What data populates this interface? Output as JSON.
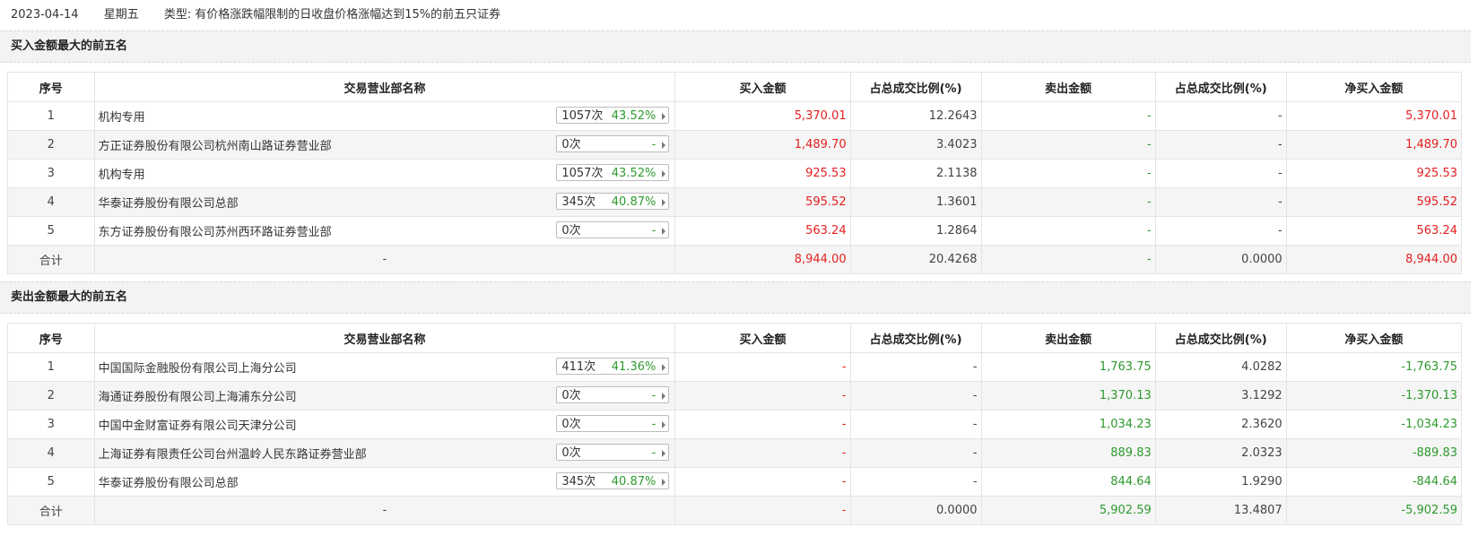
{
  "header": {
    "date": "2023-04-14",
    "weekday": "星期五",
    "type_label": "类型:",
    "type_value": "有价格涨跌幅限制的日收盘价格涨幅达到15%的前五只证券"
  },
  "columns": [
    "序号",
    "交易营业部名称",
    "买入金额",
    "占总成交比例(%)",
    "卖出金额",
    "占总成交比例(%)",
    "净买入金额"
  ],
  "buy_section": {
    "title": "买入金额最大的前五名",
    "rows": [
      {
        "idx": "1",
        "name": "机构专用",
        "count": "1057次",
        "pct": "43.52%",
        "buy": "5,370.01",
        "buy_ratio": "12.2643",
        "sell": "-",
        "sell_ratio": "-",
        "net": "5,370.01"
      },
      {
        "idx": "2",
        "name": "方正证券股份有限公司杭州南山路证券营业部",
        "count": "0次",
        "pct": "-",
        "buy": "1,489.70",
        "buy_ratio": "3.4023",
        "sell": "-",
        "sell_ratio": "-",
        "net": "1,489.70"
      },
      {
        "idx": "3",
        "name": "机构专用",
        "count": "1057次",
        "pct": "43.52%",
        "buy": "925.53",
        "buy_ratio": "2.1138",
        "sell": "-",
        "sell_ratio": "-",
        "net": "925.53"
      },
      {
        "idx": "4",
        "name": "华泰证券股份有限公司总部",
        "count": "345次",
        "pct": "40.87%",
        "buy": "595.52",
        "buy_ratio": "1.3601",
        "sell": "-",
        "sell_ratio": "-",
        "net": "595.52"
      },
      {
        "idx": "5",
        "name": "东方证券股份有限公司苏州西环路证券营业部",
        "count": "0次",
        "pct": "-",
        "buy": "563.24",
        "buy_ratio": "1.2864",
        "sell": "-",
        "sell_ratio": "-",
        "net": "563.24"
      }
    ],
    "total": {
      "label": "合计",
      "name": "-",
      "buy": "8,944.00",
      "buy_ratio": "20.4268",
      "sell": "-",
      "sell_ratio": "0.0000",
      "net": "8,944.00"
    }
  },
  "sell_section": {
    "title": "卖出金额最大的前五名",
    "rows": [
      {
        "idx": "1",
        "name": "中国国际金融股份有限公司上海分公司",
        "count": "411次",
        "pct": "41.36%",
        "buy": "-",
        "buy_ratio": "-",
        "sell": "1,763.75",
        "sell_ratio": "4.0282",
        "net": "-1,763.75"
      },
      {
        "idx": "2",
        "name": "海通证券股份有限公司上海浦东分公司",
        "count": "0次",
        "pct": "-",
        "buy": "-",
        "buy_ratio": "-",
        "sell": "1,370.13",
        "sell_ratio": "3.1292",
        "net": "-1,370.13"
      },
      {
        "idx": "3",
        "name": "中国中金财富证券有限公司天津分公司",
        "count": "0次",
        "pct": "-",
        "buy": "-",
        "buy_ratio": "-",
        "sell": "1,034.23",
        "sell_ratio": "2.3620",
        "net": "-1,034.23"
      },
      {
        "idx": "4",
        "name": "上海证券有限责任公司台州温岭人民东路证券营业部",
        "count": "0次",
        "pct": "-",
        "buy": "-",
        "buy_ratio": "-",
        "sell": "889.83",
        "sell_ratio": "2.0323",
        "net": "-889.83"
      },
      {
        "idx": "5",
        "name": "华泰证券股份有限公司总部",
        "count": "345次",
        "pct": "40.87%",
        "buy": "-",
        "buy_ratio": "-",
        "sell": "844.64",
        "sell_ratio": "1.9290",
        "net": "-844.64"
      }
    ],
    "total": {
      "label": "合计",
      "name": "-",
      "buy": "-",
      "buy_ratio": "0.0000",
      "sell": "5,902.59",
      "sell_ratio": "13.4807",
      "net": "-5,902.59"
    }
  },
  "colors": {
    "red": "#e61f1f",
    "green": "#2e9a2e",
    "row_alt": "#f5f5f5"
  }
}
